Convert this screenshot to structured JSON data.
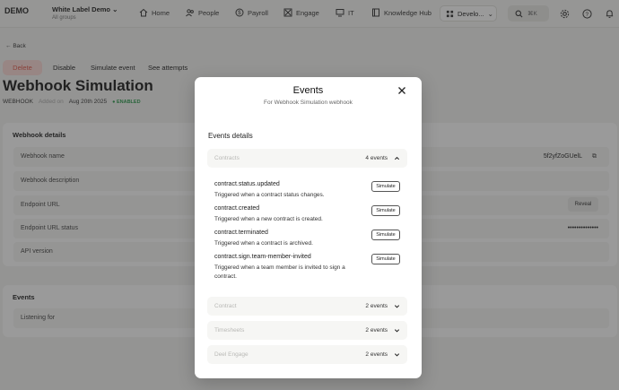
{
  "topbar": {
    "logo": "DEMO",
    "org_name": "White Label Demo",
    "org_sub": "All groups",
    "nav": [
      {
        "label": "Home",
        "icon": "home-icon"
      },
      {
        "label": "People",
        "icon": "people-icon"
      },
      {
        "label": "Payroll",
        "icon": "payroll-icon"
      },
      {
        "label": "Engage",
        "icon": "engage-icon"
      },
      {
        "label": "IT",
        "icon": "monitor-icon"
      },
      {
        "label": "Knowledge Hub",
        "icon": "book-icon"
      }
    ],
    "dev_label": "Develo...",
    "search_shortcut": "⌘K"
  },
  "page": {
    "back": "Back",
    "actions": {
      "delete": "Delete",
      "disable": "Disable",
      "simulate": "Simulate event",
      "see_attempts": "See attempts"
    },
    "title": "Webhook Simulation",
    "meta": {
      "type": "WEBHOOK",
      "added_on_label": "Added on",
      "date": "Aug 20th 2025",
      "status": "ENABLED"
    },
    "details": {
      "title": "Webhook details",
      "fields": [
        {
          "label": "Webhook name",
          "value": "5f2yfZoGUelL"
        },
        {
          "label": "Webhook description",
          "value": ""
        },
        {
          "label": "Endpoint URL",
          "value": ""
        },
        {
          "label": "Endpoint URL status",
          "value": "••••••••••••••"
        },
        {
          "label": "API version",
          "value": ""
        }
      ],
      "reveal": "Reveal"
    },
    "events": {
      "title": "Events",
      "listening_for": "Listening for"
    }
  },
  "modal": {
    "title": "Events",
    "subtitle": "For Webhook Simulation webhook",
    "section": "Events details",
    "simulate_label": "Simulate",
    "groups": [
      {
        "name": "Contracts",
        "count": "4 events",
        "expanded": true,
        "events": [
          {
            "name": "contract.status.updated",
            "desc": "Triggered when a contract status changes."
          },
          {
            "name": "contract.created",
            "desc": "Triggered when a new contract is created."
          },
          {
            "name": "contract.terminated",
            "desc": "Triggered when a contract is archived."
          },
          {
            "name": "contract.sign.team-member-invited",
            "desc": "Triggered when a team member is invited to sign a contract."
          }
        ]
      },
      {
        "name": "Contract",
        "count": "2 events",
        "expanded": false
      },
      {
        "name": "Timesheets",
        "count": "2 events",
        "expanded": false
      },
      {
        "name": "Deel Engage",
        "count": "2 events",
        "expanded": false
      }
    ]
  }
}
